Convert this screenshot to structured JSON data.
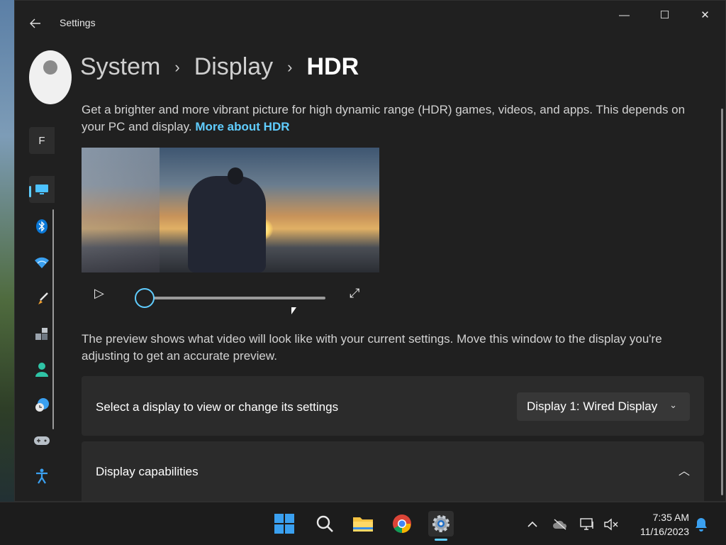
{
  "window": {
    "app_title": "Settings",
    "controls": {
      "minimize": "—",
      "maximize": "☐",
      "close": "✕"
    }
  },
  "nav": {
    "find_letter": "F",
    "items": [
      {
        "name": "system",
        "icon": "monitor-icon",
        "active": true
      },
      {
        "name": "bluetooth",
        "icon": "bluetooth-icon"
      },
      {
        "name": "network",
        "icon": "wifi-icon"
      },
      {
        "name": "personalization",
        "icon": "brush-icon"
      },
      {
        "name": "apps",
        "icon": "apps-icon"
      },
      {
        "name": "accounts",
        "icon": "person-icon"
      },
      {
        "name": "time-language",
        "icon": "clock-globe-icon"
      },
      {
        "name": "gaming",
        "icon": "gamepad-icon"
      },
      {
        "name": "accessibility",
        "icon": "accessibility-icon"
      }
    ]
  },
  "breadcrumb": {
    "items": [
      "System",
      "Display"
    ],
    "current": "HDR",
    "separator": "›"
  },
  "description": {
    "text": "Get a brighter and more vibrant picture for high dynamic range (HDR) games, videos, and apps. This depends on your PC and display.",
    "link": "More about HDR"
  },
  "player": {
    "play_icon": "▷",
    "fullscreen_icon": "⤢",
    "position": 0
  },
  "preview_note": "The preview shows what video will look like with your current settings. Move this window to the display you're adjusting to get an accurate preview.",
  "display_select": {
    "label": "Select a display to view or change its settings",
    "selected": "Display 1: Wired Display",
    "chevron": "⌄"
  },
  "capabilities": {
    "label": "Display capabilities",
    "chevron": "︿"
  },
  "taskbar": {
    "clock_time": "7:35 AM",
    "clock_date": "11/16/2023"
  },
  "colors": {
    "accent": "#60cdff",
    "window_bg": "#202020",
    "card_bg": "#2b2b2b"
  }
}
